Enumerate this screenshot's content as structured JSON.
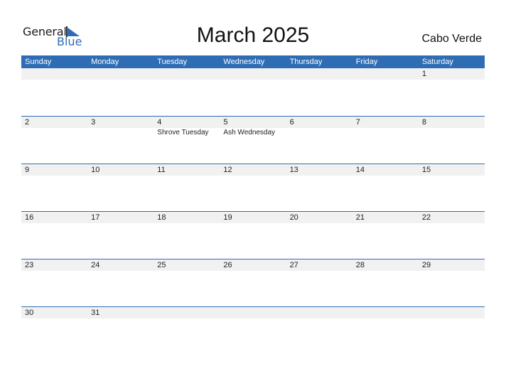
{
  "logo": {
    "line1": "General",
    "line2": "Blue"
  },
  "title": "March 2025",
  "country": "Cabo Verde",
  "colors": {
    "accent": "#2e6db4",
    "row_bar": "#f1f1f1"
  },
  "weekdays": [
    "Sunday",
    "Monday",
    "Tuesday",
    "Wednesday",
    "Thursday",
    "Friday",
    "Saturday"
  ],
  "weeks": [
    {
      "days": [
        {
          "num": "",
          "hol": ""
        },
        {
          "num": "",
          "hol": ""
        },
        {
          "num": "",
          "hol": ""
        },
        {
          "num": "",
          "hol": ""
        },
        {
          "num": "",
          "hol": ""
        },
        {
          "num": "",
          "hol": ""
        },
        {
          "num": "1",
          "hol": ""
        }
      ]
    },
    {
      "days": [
        {
          "num": "2",
          "hol": ""
        },
        {
          "num": "3",
          "hol": ""
        },
        {
          "num": "4",
          "hol": "Shrove Tuesday"
        },
        {
          "num": "5",
          "hol": "Ash Wednesday"
        },
        {
          "num": "6",
          "hol": ""
        },
        {
          "num": "7",
          "hol": ""
        },
        {
          "num": "8",
          "hol": ""
        }
      ]
    },
    {
      "days": [
        {
          "num": "9",
          "hol": ""
        },
        {
          "num": "10",
          "hol": ""
        },
        {
          "num": "11",
          "hol": ""
        },
        {
          "num": "12",
          "hol": ""
        },
        {
          "num": "13",
          "hol": ""
        },
        {
          "num": "14",
          "hol": ""
        },
        {
          "num": "15",
          "hol": ""
        }
      ]
    },
    {
      "days": [
        {
          "num": "16",
          "hol": ""
        },
        {
          "num": "17",
          "hol": ""
        },
        {
          "num": "18",
          "hol": ""
        },
        {
          "num": "19",
          "hol": ""
        },
        {
          "num": "20",
          "hol": ""
        },
        {
          "num": "21",
          "hol": ""
        },
        {
          "num": "22",
          "hol": ""
        }
      ]
    },
    {
      "days": [
        {
          "num": "23",
          "hol": ""
        },
        {
          "num": "24",
          "hol": ""
        },
        {
          "num": "25",
          "hol": ""
        },
        {
          "num": "26",
          "hol": ""
        },
        {
          "num": "27",
          "hol": ""
        },
        {
          "num": "28",
          "hol": ""
        },
        {
          "num": "29",
          "hol": ""
        }
      ]
    },
    {
      "days": [
        {
          "num": "30",
          "hol": ""
        },
        {
          "num": "31",
          "hol": ""
        },
        {
          "num": "",
          "hol": ""
        },
        {
          "num": "",
          "hol": ""
        },
        {
          "num": "",
          "hol": ""
        },
        {
          "num": "",
          "hol": ""
        },
        {
          "num": "",
          "hol": ""
        }
      ]
    }
  ]
}
